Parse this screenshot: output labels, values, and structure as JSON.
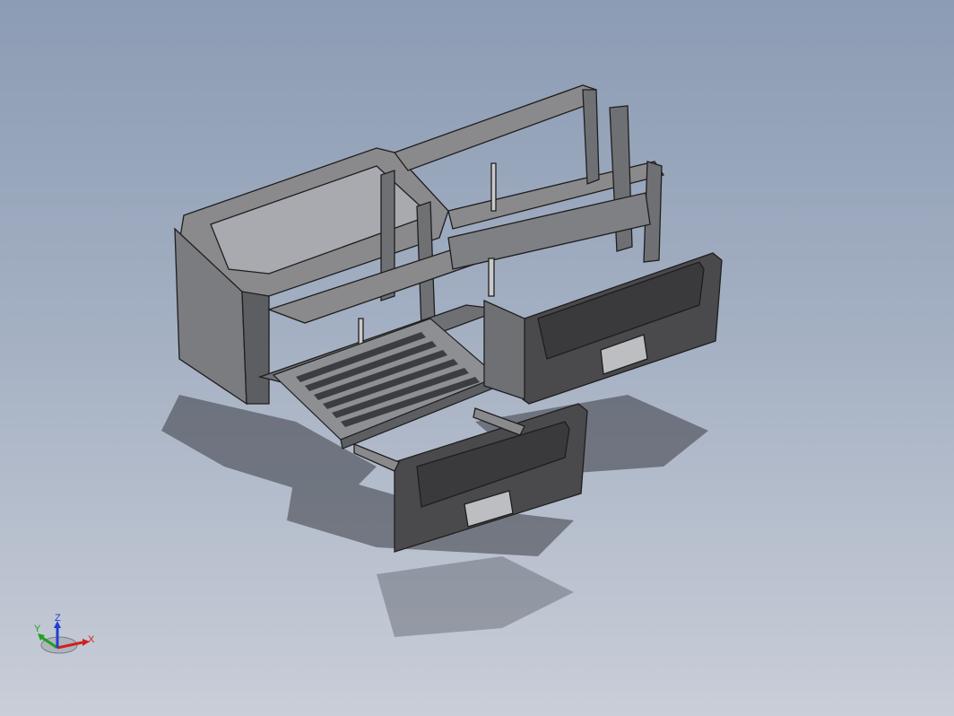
{
  "viewport": {
    "background_top": "#8c9cb4",
    "background_bottom": "#c9ced8"
  },
  "model": {
    "panel_color": "#4a4a4c",
    "frame_color": "#8a8a8c",
    "edge_color": "#1e1e1e"
  },
  "triad": {
    "x_label": "X",
    "y_label": "Y",
    "z_label": "Z",
    "x_color": "#d02020",
    "y_color": "#20a020",
    "z_color": "#2040d0"
  }
}
